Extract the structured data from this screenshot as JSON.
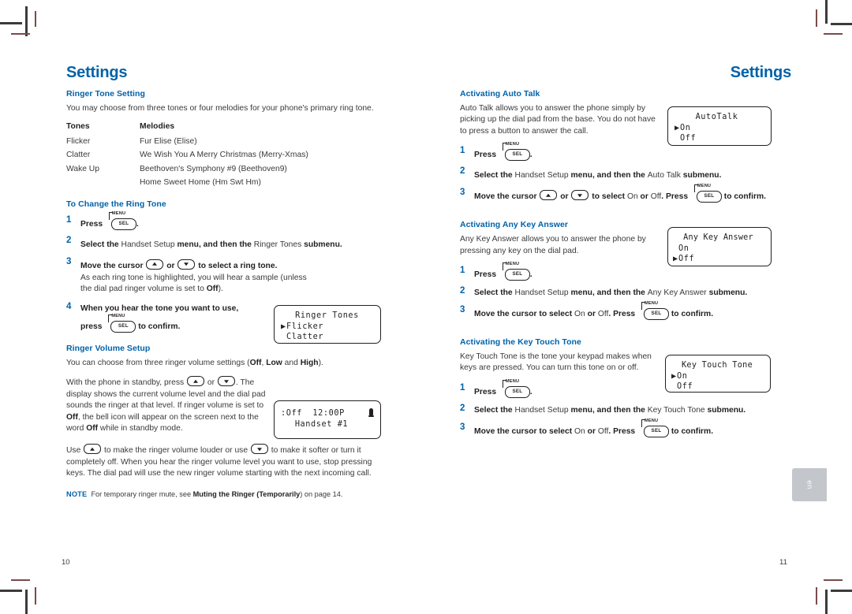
{
  "document": {
    "running_head_left": "Settings",
    "running_head_right": "Settings",
    "folio_left": "10",
    "folio_right": "11",
    "language_tab": "en"
  },
  "icons": {
    "menu_label": "MENU",
    "sel_label": "SEL",
    "bell": "bell-icon",
    "up_arrow": "arrow-up-icon",
    "down_arrow": "arrow-down-icon"
  },
  "colors": {
    "heading_blue": "#0062a9",
    "body_gray": "#3a3a3a",
    "ink_black": "#231f20",
    "tab_gray": "#c3c6cb"
  },
  "left_column": {
    "ringer_tone_setting": {
      "heading": "Ringer Tone Setting",
      "intro": "You may choose from three tones or four melodies for your phone's primary ring tone.",
      "table": {
        "headers": [
          "Tones",
          "Melodies"
        ],
        "rows": [
          [
            "Flicker",
            "Fur Elise (Elise)"
          ],
          [
            "Clatter",
            "We Wish You A Merry Christmas (Merry-Xmas)"
          ],
          [
            "Wake Up",
            "Beethoven's Symphony #9 (Beethoven9)"
          ],
          [
            "",
            "Home Sweet Home (Hm Swt Hm)"
          ]
        ]
      }
    },
    "change_ring_tone": {
      "heading": "To Change the Ring Tone",
      "steps": [
        {
          "num": "1",
          "pre": "Press ",
          "key": "menu-sel",
          "post": "."
        },
        {
          "num": "2",
          "a": "Select the ",
          "b": "Handset Setup",
          "c": " menu, and then the ",
          "d": "Ringer Tones",
          "e": " submenu."
        },
        {
          "num": "3",
          "a": "Move the cursor ",
          "b": " or ",
          "c": " to select a ring tone.",
          "sub_a": "As each ring tone is highlighted, you will hear a sample (unless the dial pad ringer volume is set to ",
          "sub_b": "Off",
          "sub_c": ")."
        },
        {
          "num": "4",
          "a": "When you hear the tone you want to use,",
          "b": "press ",
          "c": " to confirm."
        }
      ],
      "lcd": {
        "title": "Ringer Tones",
        "items": [
          {
            "cursor": true,
            "label": "Flicker"
          },
          {
            "cursor": false,
            "label": "Clatter"
          }
        ]
      }
    },
    "ringer_volume_setup": {
      "heading": "Ringer Volume Setup",
      "intro_a": "You can choose from three ringer volume settings (",
      "intro_off": "Off",
      "intro_b": ", ",
      "intro_low": "Low",
      "intro_c": " and ",
      "intro_high": "High",
      "intro_d": ").",
      "para2_a": "With the phone in standby, press ",
      "para2_b": " or ",
      "para2_c": ".",
      "para2_d": "The display shows the current volume level and the dial pad sounds the ringer at that level. If ringer volume is set to ",
      "para2_off": "Off",
      "para2_e": ", the bell icon will appear on the screen next to the word ",
      "para2_off2": "Off",
      "para2_f": " while in standby mode.",
      "para3_a": "Use ",
      "para3_b": " to make the ringer volume louder or use ",
      "para3_c": " to make it softer or turn it completely off. When you hear the ringer volume level you want to use, stop pressing keys. The dial pad will use the new ringer volume starting with the next incoming call.",
      "lcd": {
        "line1_left": ":Off",
        "line1_time": "12:00P",
        "line2": "Handset #1",
        "bell_icon": true
      },
      "note": {
        "tag": "NOTE",
        "a": "For temporary ringer mute, see ",
        "b": "Muting the Ringer (Temporarily",
        "c": ") on page 14."
      }
    }
  },
  "right_column": {
    "auto_talk": {
      "heading": "Activating Auto Talk",
      "intro": "Auto Talk allows you to answer the phone simply by picking up the dial pad from the base. You do not have to press a button to answer the call.",
      "lcd": {
        "title": "AutoTalk",
        "items": [
          {
            "cursor": true,
            "label": "On"
          },
          {
            "cursor": false,
            "label": "Off"
          }
        ]
      },
      "steps": [
        {
          "num": "1",
          "pre": "Press ",
          "post": "."
        },
        {
          "num": "2",
          "a": "Select the ",
          "b": "Handset Setup",
          "c": " menu, and then the ",
          "d": "Auto Talk",
          "e": " submenu."
        },
        {
          "num": "3",
          "a": "Move the cursor ",
          "b": " or ",
          "c": " to select ",
          "d": "On",
          "e": " or ",
          "f": "Off",
          "g": ". Press ",
          "h": " to confirm."
        }
      ]
    },
    "any_key_answer": {
      "heading": "Activating Any Key Answer",
      "intro": "Any Key Answer allows you to answer the phone by pressing any key on the dial pad.",
      "lcd": {
        "title": "Any Key Answer",
        "items": [
          {
            "cursor": false,
            "label": "On"
          },
          {
            "cursor": true,
            "label": "Off"
          }
        ]
      },
      "steps": [
        {
          "num": "1",
          "pre": "Press ",
          "post": "."
        },
        {
          "num": "2",
          "a": "Select the ",
          "b": "Handset Setup",
          "c": " menu, and then the ",
          "d": "Any Key Answer",
          "e": " submenu."
        },
        {
          "num": "3",
          "a": "Move the cursor to select ",
          "d": "On",
          "e": " or ",
          "f": "Off",
          "g": ". Press ",
          "h": " to confirm."
        }
      ]
    },
    "key_touch_tone": {
      "heading": "Activating the Key Touch Tone",
      "intro": "Key Touch Tone is the tone your keypad makes when keys are pressed. You can turn this tone on or off.",
      "lcd": {
        "title": "Key Touch Tone",
        "items": [
          {
            "cursor": true,
            "label": "On"
          },
          {
            "cursor": false,
            "label": "Off"
          }
        ]
      },
      "steps": [
        {
          "num": "1",
          "pre": "Press ",
          "post": "."
        },
        {
          "num": "2",
          "a": "Select the ",
          "b": "Handset Setup",
          "c": " menu, and then the ",
          "d": "Key Touch Tone",
          "e": " submenu."
        },
        {
          "num": "3",
          "a": "Move the cursor to select ",
          "d": "On",
          "e": " or ",
          "f": "Off",
          "g": ". Press ",
          "h": " to confirm."
        }
      ]
    }
  }
}
